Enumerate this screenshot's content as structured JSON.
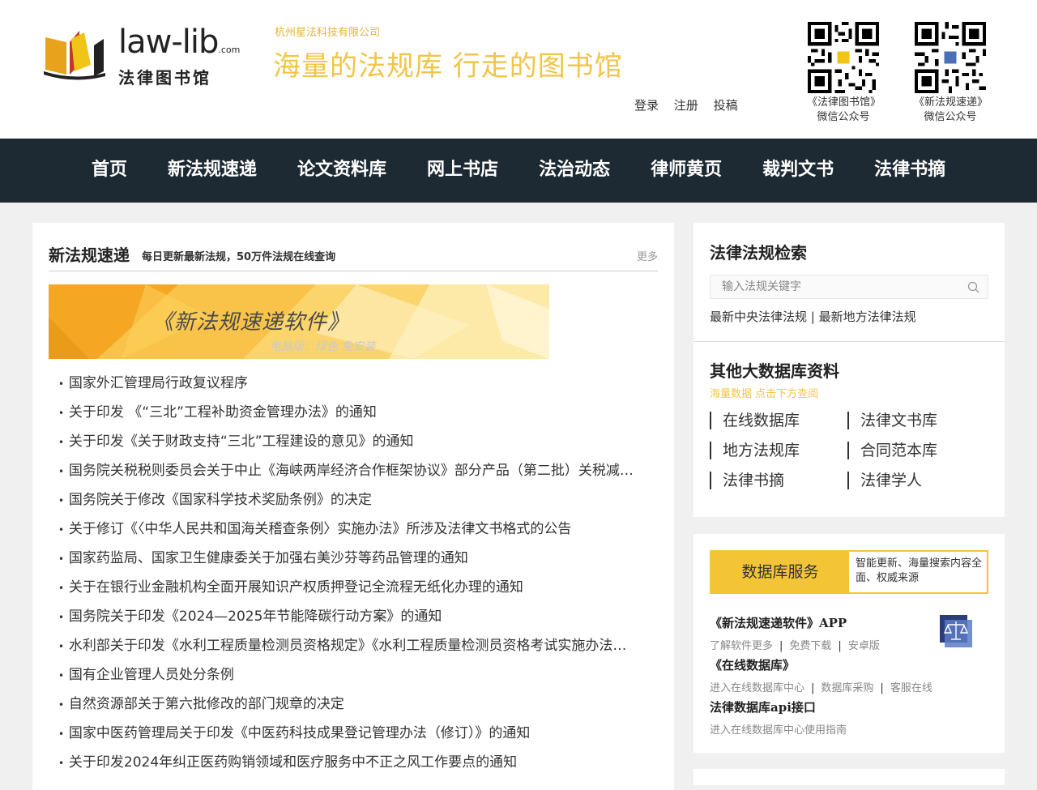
{
  "header": {
    "logo_en": "law-lib",
    "logo_en_suffix": ".com",
    "logo_cn": "法律图书馆",
    "company": "杭州星法科技有限公司",
    "slogan": "海量的法规库  行走的图书馆",
    "auth": [
      "登录",
      "注册",
      "投稿"
    ],
    "qr": [
      {
        "line1": "《法律图书馆》",
        "line2": "微信公众号"
      },
      {
        "line1": "《新法规速递》",
        "line2": "微信公众号"
      }
    ]
  },
  "nav": [
    "首页",
    "新法规速递",
    "论文资料库",
    "网上书店",
    "法治动态",
    "律师黄页",
    "裁判文书",
    "法律书摘"
  ],
  "left": {
    "title": "新法规速递",
    "subtitle": "每日更新最新法规，50万件法规在线查询",
    "more": "更多",
    "banner_title": "《新法规速递软件》",
    "banner_sub": "电脑版：绿色 免安装",
    "items": [
      "国家外汇管理局行政复议程序",
      "关于印发 《“三北”工程补助资金管理办法》的通知",
      "关于印发《关于财政支持“三北”工程建设的意见》的通知",
      "国务院关税税则委员会关于中止《海峡两岸经济合作框架协议》部分产品（第二批）关税减让的公告",
      "国务院关于修改《国家科学技术奖励条例》的决定",
      "关于修订《〈中华人民共和国海关稽查条例〉实施办法》所涉及法律文书格式的公告",
      "国家药监局、国家卫生健康委关于加强右美沙芬等药品管理的通知",
      "关于在银行业金融机构全面开展知识产权质押登记全流程无纸化办理的通知",
      "国务院关于印发《2024—2025年节能降碳行动方案》的通知",
      "水利部关于印发《水利工程质量检测员资格规定》《水利工程质量检测员资格考试实施办法》的通知",
      "国有企业管理人员处分条例",
      "自然资源部关于第六批修改的部门规章的决定",
      "国家中医药管理局关于印发《中医药科技成果登记管理办法（修订）》的通知",
      "关于印发2024年纠正医药购销领域和医疗服务中不正之风工作要点的通知"
    ]
  },
  "search_panel": {
    "title": "法律法规检索",
    "placeholder": "输入法规关键字",
    "link1": "最新中央法律法规",
    "link_sep": " | ",
    "link2": "最新地方法律法规"
  },
  "db_panel": {
    "title": "其他大数据库资料",
    "hint": "海量数据 点击下方查阅",
    "items": [
      "在线数据库",
      "法律文书库",
      "地方法规库",
      "合同范本库",
      "法律书摘",
      "法律学人"
    ]
  },
  "service": {
    "label": "数据库服务",
    "desc": "智能更新、海量搜索内容全面、权威来源",
    "app_title": "《新法规速递软件》APP",
    "app_links": [
      "了解软件更多",
      "免费下载",
      "安卓版"
    ],
    "online_title": "《在线数据库》",
    "online_links": [
      "进入在线数据库中心",
      "数据库采购",
      "客服在线"
    ],
    "api_title": "法律数据库api接口",
    "api_link": "进入在线数据库中心使用指南"
  },
  "colors": {
    "nav_bg": "#1d2a33",
    "accent_yellow": "#f3c536",
    "slogan_yellow": "#f2c447",
    "page_bg": "#f0f0f0"
  }
}
